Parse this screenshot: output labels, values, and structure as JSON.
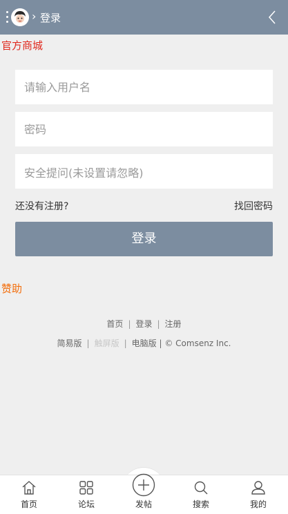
{
  "header": {
    "title": "登录",
    "separator": "›"
  },
  "brand_link": "官方商城",
  "form": {
    "username_placeholder": "请输入用户名",
    "password_placeholder": "密码",
    "security_question": "安全提问(未设置请忽略)",
    "register_prompt": "还没有注册?",
    "forgot_password": "找回密码",
    "login_button": "登录"
  },
  "sponsor": "赞助",
  "footer": {
    "line1": [
      "首页",
      "登录",
      "注册"
    ],
    "line2": [
      "简易版",
      "触屏版",
      "电脑版"
    ],
    "copyright": "| © Comsenz Inc.",
    "divider": "|"
  },
  "tabbar": {
    "items": [
      {
        "label": "首页",
        "icon": "home-icon"
      },
      {
        "label": "论坛",
        "icon": "grid-icon"
      },
      {
        "label": "发帖",
        "icon": "plus-circle-icon"
      },
      {
        "label": "搜索",
        "icon": "search-icon"
      },
      {
        "label": "我的",
        "icon": "user-icon"
      }
    ]
  },
  "colors": {
    "header": "#7c8da0",
    "brand_link": "#e0281d",
    "sponsor": "#f36c08"
  }
}
